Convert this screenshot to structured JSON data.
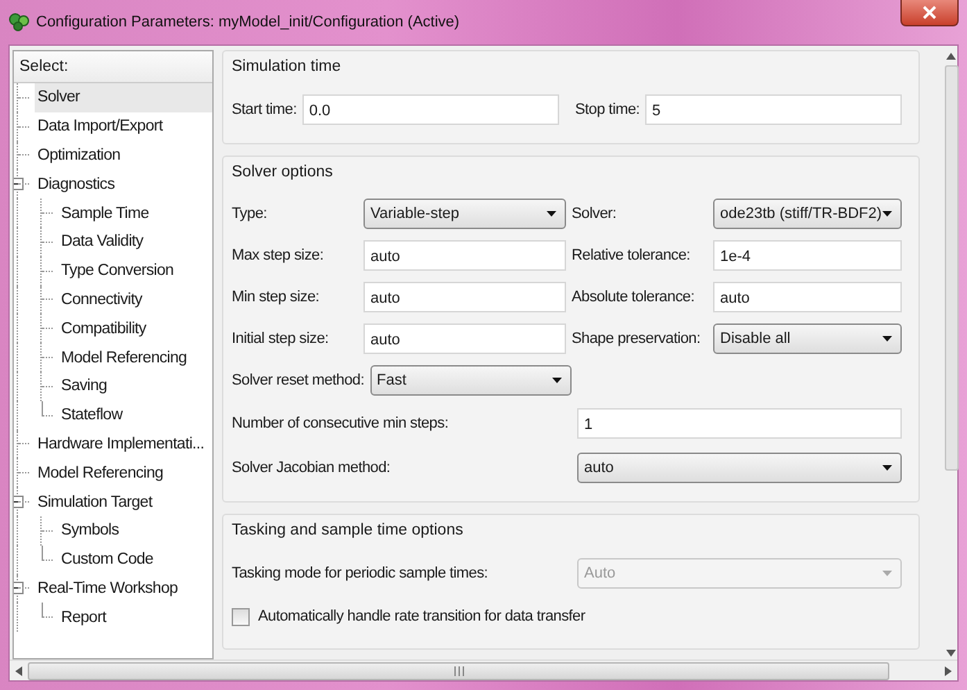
{
  "window": {
    "title": "Configuration Parameters: myModel_init/Configuration (Active)"
  },
  "tree": {
    "header": "Select:",
    "items": [
      {
        "label": "Solver",
        "selected": true
      },
      {
        "label": "Data Import/Export",
        "selected": false
      },
      {
        "label": "Optimization",
        "selected": false
      },
      {
        "label": "Diagnostics",
        "selected": false,
        "expanded": true,
        "children": [
          {
            "label": "Sample Time",
            "selected": false
          },
          {
            "label": "Data Validity",
            "selected": false
          },
          {
            "label": "Type Conversion",
            "selected": false
          },
          {
            "label": "Connectivity",
            "selected": false
          },
          {
            "label": "Compatibility",
            "selected": false
          },
          {
            "label": "Model Referencing",
            "selected": false
          },
          {
            "label": "Saving",
            "selected": false
          },
          {
            "label": "Stateflow",
            "selected": false
          }
        ]
      },
      {
        "label": "Hardware Implementati...",
        "selected": false
      },
      {
        "label": "Model Referencing",
        "selected": false
      },
      {
        "label": "Simulation Target",
        "selected": false,
        "expanded": true,
        "children": [
          {
            "label": "Symbols",
            "selected": false
          },
          {
            "label": "Custom Code",
            "selected": false
          }
        ]
      },
      {
        "label": "Real-Time Workshop",
        "selected": false,
        "expanded": true,
        "children": [
          {
            "label": "Report",
            "selected": false
          }
        ]
      }
    ]
  },
  "sections": [
    {
      "title": "Simulation time",
      "rows": [
        {
          "kind": "inline-pair",
          "cells": [
            {
              "label": "Start time:",
              "kind": "text",
              "value": "0.0"
            },
            {
              "label": "Stop time:",
              "kind": "text",
              "value": "5"
            }
          ]
        }
      ]
    },
    {
      "title": "Solver options",
      "rows": [
        {
          "kind": "pair",
          "cells": [
            {
              "label": "Type:",
              "kind": "dropdown",
              "value": "Variable-step"
            },
            {
              "label": "Solver:",
              "kind": "dropdown",
              "value": "ode23tb (stiff/TR-BDF2)"
            }
          ]
        },
        {
          "kind": "pair",
          "cells": [
            {
              "label": "Max step size:",
              "kind": "text",
              "value": "auto"
            },
            {
              "label": "Relative tolerance:",
              "kind": "text",
              "value": "1e-4"
            }
          ]
        },
        {
          "kind": "pair",
          "cells": [
            {
              "label": "Min step size:",
              "kind": "text",
              "value": "auto"
            },
            {
              "label": "Absolute tolerance:",
              "kind": "text",
              "value": "auto"
            }
          ]
        },
        {
          "kind": "pair",
          "cells": [
            {
              "label": "Initial step size:",
              "kind": "text",
              "value": "auto"
            },
            {
              "label": "Shape preservation:",
              "kind": "dropdown",
              "value": "Disable all"
            }
          ]
        },
        {
          "kind": "single",
          "cells": [
            {
              "label": "Solver reset method:",
              "kind": "dropdown",
              "value": "Fast"
            }
          ]
        },
        {
          "kind": "wide",
          "cells": [
            {
              "label": "Number of consecutive min steps:",
              "kind": "text",
              "value": "1"
            }
          ]
        },
        {
          "kind": "wide",
          "cells": [
            {
              "label": "Solver Jacobian method:",
              "kind": "dropdown",
              "value": "auto"
            }
          ]
        }
      ]
    },
    {
      "title": "Tasking and sample time options",
      "rows": [
        {
          "kind": "wide",
          "cells": [
            {
              "label": "Tasking mode for periodic sample times:",
              "kind": "dropdown",
              "value": "Auto",
              "disabled": true
            }
          ]
        },
        {
          "kind": "checkbox",
          "cells": [
            {
              "label": "Automatically handle rate transition for data transfer",
              "kind": "checkbox",
              "checked": false
            }
          ]
        }
      ]
    }
  ]
}
